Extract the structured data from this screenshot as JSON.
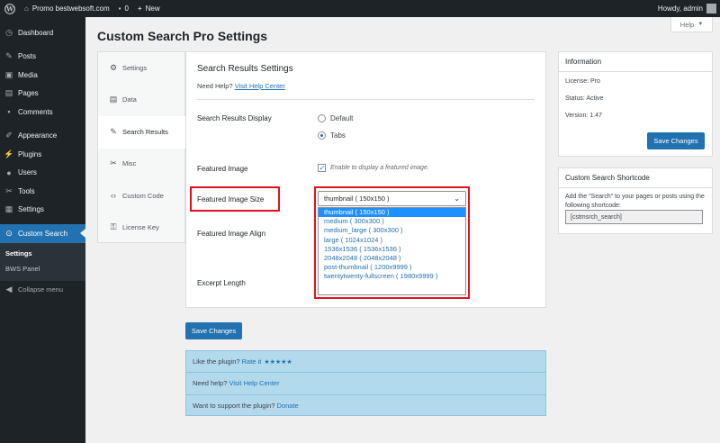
{
  "adminbar": {
    "site_name": "Promo bestwebsoft.com",
    "comments_count": "0",
    "new_label": "New",
    "howdy": "Howdy, admin"
  },
  "sidebar": {
    "items": [
      {
        "label": "Dashboard",
        "icon": "dashboard-icon"
      },
      {
        "label": "Posts",
        "icon": "pin-icon"
      },
      {
        "label": "Media",
        "icon": "media-icon"
      },
      {
        "label": "Pages",
        "icon": "pages-icon"
      },
      {
        "label": "Comments",
        "icon": "comments-icon"
      },
      {
        "label": "Appearance",
        "icon": "brush-icon"
      },
      {
        "label": "Plugins",
        "icon": "plug-icon"
      },
      {
        "label": "Users",
        "icon": "users-icon"
      },
      {
        "label": "Tools",
        "icon": "wrench-icon"
      },
      {
        "label": "Settings",
        "icon": "settings-icon"
      },
      {
        "label": "Custom Search",
        "icon": "search-icon"
      }
    ],
    "submenu": [
      "Settings",
      "BWS Panel"
    ],
    "collapse": "Collapse menu"
  },
  "help_label": "Help",
  "page_title": "Custom Search Pro Settings",
  "tabs": [
    "Settings",
    "Data",
    "Search Results",
    "Misc",
    "Custom Code",
    "License Key"
  ],
  "content": {
    "heading": "Search Results Settings",
    "need_help": "Need Help?",
    "help_link": "Visit Help Center",
    "display_label": "Search Results Display",
    "radio_default": "Default",
    "radio_tabs": "Tabs",
    "featured_label": "Featured Image",
    "featured_cb": "Enable to display a featured image.",
    "size_label": "Featured Image Size",
    "align_label": "Featured Image Align",
    "excerpt_label": "Excerpt Length",
    "selected_size": "thumbnail ( 150x150 )",
    "size_options": [
      "thumbnail ( 150x150 )",
      "medium ( 300x300 )",
      "medium_large ( 300x300 )",
      "large ( 1024x1024 )",
      "1536x1536 ( 1536x1536 )",
      "2048x2048 ( 2048x2048 )",
      "post-thumbnail ( 1200x9999 )",
      "twentytwenty-fullscreen ( 1980x9999 )"
    ]
  },
  "save_label": "Save Changes",
  "info_box": {
    "rate_text": "Like the plugin?",
    "rate_link": "Rate it",
    "stars": "★★★★★",
    "help_text": "Need help?",
    "help_link": "Visit Help Center",
    "support_text": "Want to support the plugin?",
    "support_link": "Donate"
  },
  "information": {
    "title": "Information",
    "license": "License: Pro",
    "status": "Status: Active",
    "version": "Version: 1.47",
    "save_label": "Save Changes"
  },
  "shortcode": {
    "title": "Custom Search Shortcode",
    "desc": "Add the \"Search\" to your pages or posts using the following shortcode:",
    "value": "[cstmsrch_search]"
  }
}
